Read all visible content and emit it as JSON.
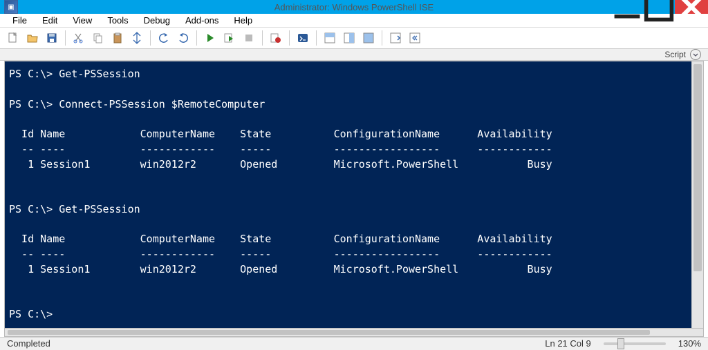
{
  "window": {
    "title": "Administrator: Windows PowerShell ISE"
  },
  "menu": {
    "items": [
      "File",
      "Edit",
      "View",
      "Tools",
      "Debug",
      "Add-ons",
      "Help"
    ]
  },
  "scriptbar": {
    "label": "Script"
  },
  "console": {
    "prompt": "PS C:\\>",
    "commands": {
      "cmd1": "Get-PSSession",
      "cmd2": "Connect-PSSession $RemoteComputer",
      "cmd3": "Get-PSSession"
    },
    "table_header": {
      "c1": "Id",
      "c2": "Name",
      "c3": "ComputerName",
      "c4": "State",
      "c5": "ConfigurationName",
      "c6": "Availability"
    },
    "rows": [
      {
        "id": "1",
        "name": "Session1",
        "comp": "win2012r2",
        "state": "Opened",
        "conf": "Microsoft.PowerShell",
        "avail": "Busy"
      }
    ]
  },
  "status": {
    "left": "Completed",
    "pos": "Ln 21  Col 9",
    "zoom": "130%"
  },
  "colors": {
    "titlebar": "#00a2e8",
    "console_bg": "#012456",
    "close_btn": "#e04040"
  }
}
